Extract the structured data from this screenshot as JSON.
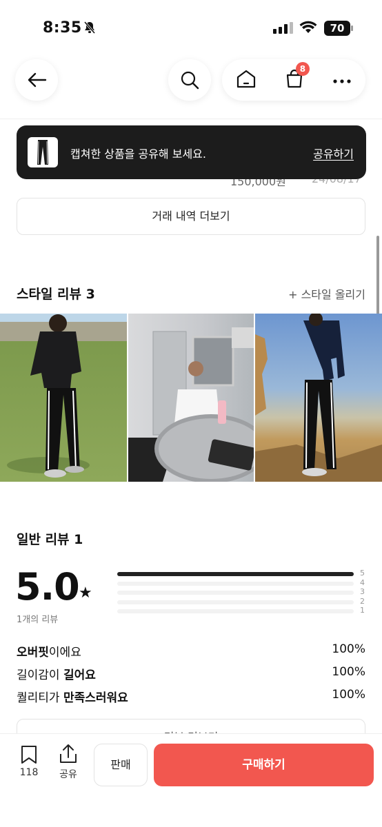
{
  "status_bar": {
    "time": "8:35",
    "battery": "70"
  },
  "nav": {
    "cart_badge": "8"
  },
  "behind_toast": {
    "price": "150,000원",
    "date": "24/08/17"
  },
  "toast": {
    "message": "캡쳐한 상품을 공유해 보세요.",
    "action": "공유하기"
  },
  "history_button": "거래 내역 더보기",
  "style_review": {
    "title": "스타일 리뷰 3",
    "link": "+ 스타일 올리기"
  },
  "general_review": {
    "title": "일반 리뷰 1",
    "score": "5.0",
    "review_count": "1개의 리뷰",
    "rating_distribution": [
      {
        "stars": "5",
        "fraction": 1.0
      },
      {
        "stars": "4",
        "fraction": 0.0
      },
      {
        "stars": "3",
        "fraction": 0.0
      },
      {
        "stars": "2",
        "fraction": 0.0
      },
      {
        "stars": "1",
        "fraction": 0.0
      }
    ],
    "attributes": [
      {
        "key": "오버핏",
        "rest": "이에요",
        "percent": "100%"
      },
      {
        "pre": "길이감이 ",
        "key": "길어요",
        "percent": "100%"
      },
      {
        "pre": "퀄리티가 ",
        "key": "만족스러워요",
        "percent": "100%"
      }
    ],
    "more_button": "리뷰 더보기"
  },
  "bottom_bar": {
    "like_count": "118",
    "share_label": "공유",
    "sell_label": "판매",
    "buy_label": "구매하기"
  },
  "colors": {
    "accent": "#f2574f",
    "toast_bg": "#1c1c1c"
  }
}
